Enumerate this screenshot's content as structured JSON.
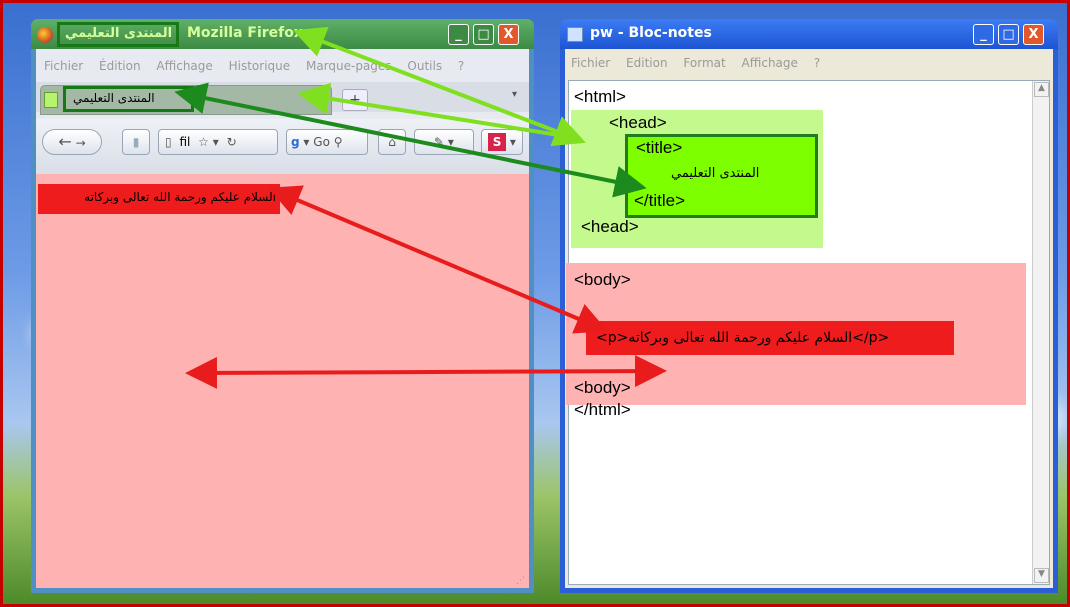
{
  "firefox": {
    "title_ar": "المنتدى التعليمي",
    "title_app": "Mozilla Firefox",
    "menu": [
      "Fichier",
      "Édition",
      "Affichage",
      "Historique",
      "Marque-pages",
      "Outils",
      "?"
    ],
    "tab_label": "المنتدى التعليمي",
    "new_tab": "+",
    "url_text": "fil",
    "search_text": "Go",
    "s_label": "S",
    "paragraph": "السلام عليكم ورحمة الله تعالى وبركاته"
  },
  "notepad": {
    "title": "pw - Bloc-notes",
    "menu": [
      "Fichier",
      "Edition",
      "Format",
      "Affichage",
      "?"
    ],
    "lines": {
      "html_open": "<html>",
      "head_open": "<head>",
      "title_open": "<title>",
      "title_text": "المنتدى التعليمي",
      "title_close": "</title>",
      "head_close": "<head>",
      "body_open": "<body>",
      "p_line": "<p>السلام عليكم ورحمة الله تعالى وبركاته</p>",
      "body_close": "<body>",
      "html_close": "</html>"
    }
  },
  "window_buttons": {
    "minimize": "_",
    "maximize": "□",
    "close": "X"
  },
  "colors": {
    "green_highlight": "#c3f98d",
    "lime_title": "#7dff00",
    "dark_green_box": "#1f7d1f",
    "red_block": "#ffb2b2",
    "red_label": "#ee1c1c",
    "arrow_light_green": "#80e020",
    "arrow_dark_green": "#1d8a1d",
    "arrow_red": "#e81c1c"
  }
}
